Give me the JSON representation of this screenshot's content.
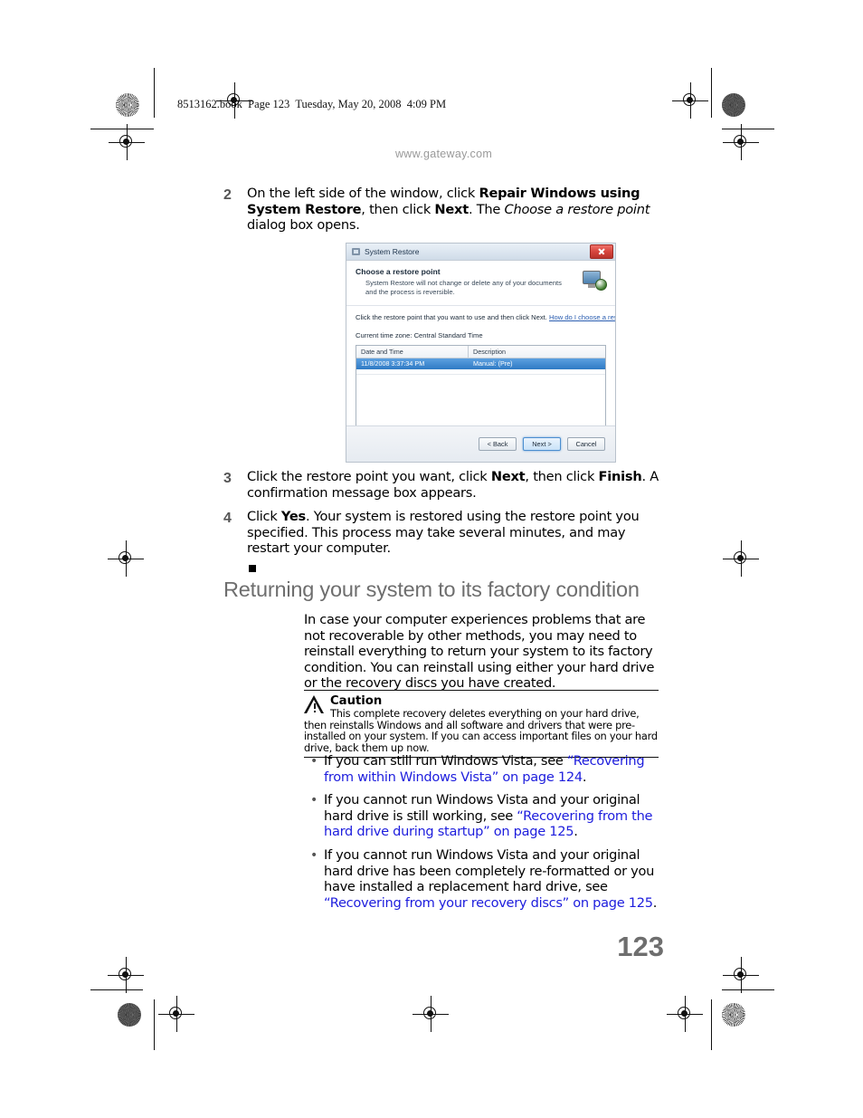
{
  "print_slug": "8513162.book  Page 123  Tuesday, May 20, 2008  4:09 PM",
  "running_head": "www.gateway.com",
  "steps": [
    {
      "number": "2",
      "html": "On the left side of the window, click <b>Repair&nbsp;Windows using System Restore</b>, then click <b>Next</b>. The <i>Choose a restore point</i> dialog box opens."
    },
    {
      "number": "3",
      "html": "Click the restore point you want, click <b>Next</b>, then click <b>Finish</b>. A confirmation message box appears."
    },
    {
      "number": "4",
      "html": "Click <b>Yes</b>. Your system is restored using the restore point you specified. This process may take several minutes, and may restart your computer."
    }
  ],
  "dialog": {
    "window_title": "System Restore",
    "heading": "Choose a restore point",
    "subheading": "System Restore will not change or delete any of your documents and the process is reversible.",
    "instruction": "Click the restore point that you want to use and then click Next.",
    "help_link": "How do I choose a restore point?",
    "time_zone": "Current time zone: Central Standard Time",
    "columns": [
      "Date and Time",
      "Description"
    ],
    "rows": [
      {
        "date_time": "11/8/2008 3:37:34 PM",
        "description": "Manual: (Pre)"
      }
    ],
    "buttons": {
      "back": "< Back",
      "next": "Next >",
      "cancel": "Cancel"
    }
  },
  "section": {
    "heading": "Returning your system to its factory condition",
    "paragraph": "In case your computer experiences problems that are not recoverable by other methods, you may need to reinstall everything to return your system to its factory condition. You can reinstall using either your hard drive or the recovery discs you have created."
  },
  "caution": {
    "title": "Caution",
    "text": "This complete recovery deletes everything on your hard drive, then reinstalls Windows and all software and drivers that were pre-installed on your system. If you can access important files on your hard drive, back them up now."
  },
  "bullets": [
    {
      "html": "If you can still run Windows Vista, see <span class=\"xref\">&ldquo;Recovering from within Windows&nbsp;Vista&rdquo; on page 124</span>."
    },
    {
      "html": "If you cannot run Windows Vista and your original hard drive is still working, see <span class=\"xref\">&ldquo;Recovering from the hard drive during startup&rdquo; on page 125</span>."
    },
    {
      "html": "If you cannot run Windows Vista and your original hard drive has been completely re-formatted or you have installed a replacement hard drive, see <span class=\"xref\">&ldquo;Recovering from your recovery discs&rdquo; on page 125</span>."
    }
  ],
  "page_number": "123",
  "colors": {
    "link": "#1d1ddd",
    "heading_gray": "#6e6e6e",
    "running_head_gray": "#9a9a9a"
  }
}
